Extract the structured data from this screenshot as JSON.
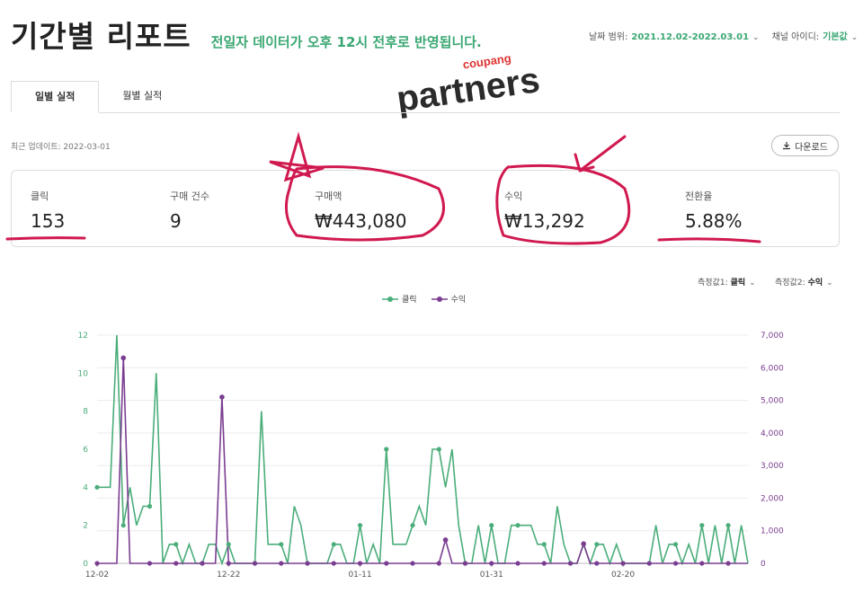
{
  "header": {
    "title": "기간별 리포트",
    "notice": "전일자 데이터가 오후 12시 전후로 반영됩니다.",
    "date_range_label": "날짜 범위:",
    "date_range_value": "2021.12.02-2022.03.01",
    "channel_label": "채널 아이디:",
    "channel_value": "기본값"
  },
  "logo": {
    "small": "coupang",
    "main": "partners"
  },
  "tabs": [
    {
      "label": "일별 실적",
      "active": true
    },
    {
      "label": "월별 실적",
      "active": false
    }
  ],
  "updated": "최근 업데이트: 2022-03-01",
  "download_label": "다운로드",
  "stats": [
    {
      "label": "클릭",
      "value": "153"
    },
    {
      "label": "구매 건수",
      "value": "9"
    },
    {
      "label": "구매액",
      "value": "₩443,080"
    },
    {
      "label": "수익",
      "value": "₩13,292"
    },
    {
      "label": "전환율",
      "value": "5.88%"
    }
  ],
  "measures": {
    "m1_label": "측정값1:",
    "m1_value": "클릭",
    "m2_label": "측정값2:",
    "m2_value": "수익"
  },
  "colors": {
    "accent": "#3aa772",
    "click": "#4aad7a",
    "revenue": "#7b3d91",
    "annotation": "#d0194f"
  },
  "chart_data": {
    "type": "line",
    "x_ticks": [
      "12-02",
      "12-22",
      "01-11",
      "01-31",
      "02-20"
    ],
    "ylim_left": [
      0,
      12
    ],
    "ylim_right": [
      0,
      7000
    ],
    "y_ticks_left": [
      "0",
      "2",
      "4",
      "6",
      "8",
      "10",
      "12"
    ],
    "y_ticks_right": [
      "0",
      "1,000",
      "2,000",
      "3,000",
      "4,000",
      "5,000",
      "6,000",
      "7,000"
    ],
    "legend_position": "top",
    "series": [
      {
        "name": "클릭",
        "axis": "left",
        "values": [
          4,
          4,
          4,
          12,
          2,
          4,
          2,
          3,
          3,
          10,
          0,
          1,
          1,
          0,
          1,
          0,
          0,
          1,
          1,
          0,
          1,
          0,
          0,
          0,
          0,
          8,
          1,
          1,
          1,
          0,
          3,
          2,
          0,
          0,
          0,
          0,
          1,
          1,
          0,
          0,
          2,
          0,
          1,
          0,
          6,
          1,
          1,
          1,
          2,
          3,
          2,
          6,
          6,
          4,
          6,
          2,
          0,
          0,
          2,
          0,
          2,
          0,
          0,
          2,
          2,
          2,
          2,
          1,
          1,
          0,
          3,
          1,
          0,
          0,
          1,
          0,
          1,
          1,
          0,
          1,
          0,
          0,
          0,
          0,
          0,
          2,
          0,
          1,
          1,
          0,
          1,
          0,
          2,
          0,
          2,
          0,
          2,
          0,
          2,
          0
        ]
      },
      {
        "name": "수익",
        "axis": "right",
        "values": [
          0,
          0,
          0,
          0,
          6300,
          0,
          0,
          0,
          0,
          0,
          0,
          0,
          0,
          0,
          0,
          0,
          0,
          0,
          0,
          5100,
          0,
          0,
          0,
          0,
          0,
          0,
          0,
          0,
          0,
          0,
          0,
          0,
          0,
          0,
          0,
          0,
          0,
          0,
          0,
          0,
          0,
          0,
          0,
          0,
          0,
          0,
          0,
          0,
          0,
          0,
          0,
          0,
          0,
          720,
          0,
          0,
          0,
          0,
          0,
          0,
          0,
          0,
          0,
          0,
          0,
          0,
          0,
          0,
          0,
          0,
          0,
          0,
          0,
          0,
          600,
          0,
          0,
          0,
          0,
          0,
          0,
          0,
          0,
          0,
          0,
          0,
          0,
          0,
          0,
          0,
          0,
          0,
          0,
          0,
          0,
          0,
          0,
          0,
          0,
          0
        ]
      }
    ]
  }
}
